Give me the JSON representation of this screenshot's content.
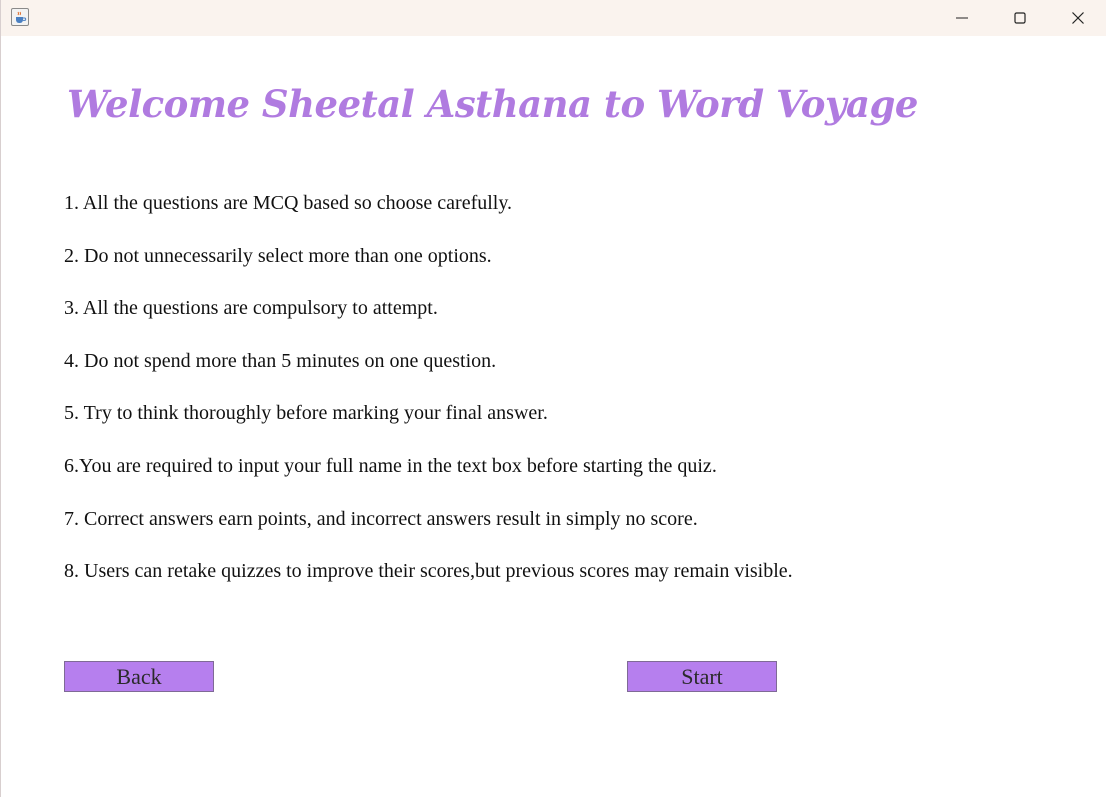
{
  "window": {
    "icon": "java-coffee-icon",
    "controls": {
      "minimize_icon": "minimize-icon",
      "maximize_icon": "maximize-icon",
      "close_icon": "close-icon"
    }
  },
  "main": {
    "title": "Welcome Sheetal Asthana to Word Voyage",
    "rules": [
      "1. All the questions are MCQ based so choose carefully.",
      "2. Do not unnecessarily select more than one options.",
      "3. All the questions are compulsory to attempt.",
      "4. Do not spend more than 5 minutes on one question.",
      "5. Try to think thoroughly before marking your final answer.",
      "6.You are required to input your full name in the text box before starting the quiz.",
      "7. Correct answers earn points, and incorrect answers result in simply no score.",
      "8. Users can retake quizzes to improve their scores,but previous scores may remain visible."
    ],
    "back_label": "Back",
    "start_label": "Start"
  },
  "colors": {
    "title": "#b07be0",
    "button_bg": "#b67fee",
    "titlebar_bg": "#faf3ee"
  }
}
